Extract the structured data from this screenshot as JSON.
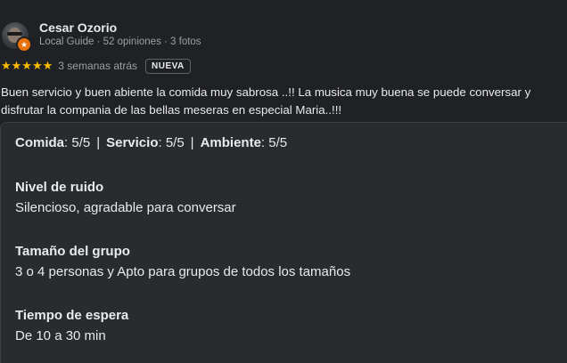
{
  "review": {
    "author": "Cesar Ozorio",
    "author_meta": "Local Guide · 52 opiniones · 3 fotos",
    "stars_glyphs": "★★★★★",
    "rating": 5,
    "date": "3 semanas atrás",
    "new_badge": "NUEVA",
    "text": "Buen servicio y buen abiente la comida muy sabrosa ..!! La musica muy buena se puede conversar y disfrutar la compania de las bellas meseras en especial Maria..!!!",
    "scores": {
      "food_label": "Comida",
      "food_value": ": 5/5",
      "service_label": "Servicio",
      "service_value": ": 5/5",
      "ambience_label": "Ambiente",
      "ambience_value": ": 5/5",
      "separator": "|"
    },
    "attributes": [
      {
        "label": "Nivel de ruido",
        "value": "Silencioso, agradable para conversar"
      },
      {
        "label": "Tamaño del grupo",
        "value": "3 o 4 personas y Apto para grupos de todos los tamaños"
      },
      {
        "label": "Tiempo de espera",
        "value": "De 10 a 30 min"
      }
    ],
    "colors": {
      "star": "#fbbc04",
      "badge_guide": "#e8710a",
      "background": "#202124",
      "panel": "#292b2e"
    }
  }
}
